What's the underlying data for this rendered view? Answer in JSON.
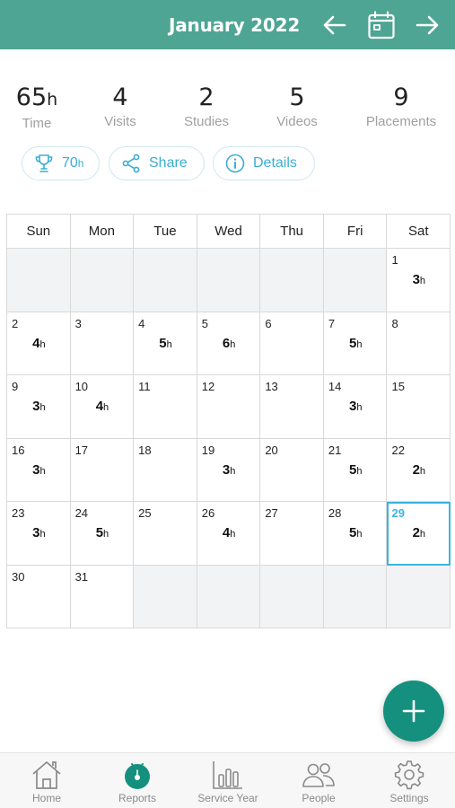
{
  "header": {
    "title": "January 2022",
    "prev_icon": "arrow-left-icon",
    "calendar_icon": "calendar-icon",
    "next_icon": "arrow-right-icon",
    "color": "#4ea593"
  },
  "stats": [
    {
      "value": "65",
      "unit": "h",
      "label": "Time"
    },
    {
      "value": "4",
      "unit": "",
      "label": "Visits"
    },
    {
      "value": "2",
      "unit": "",
      "label": "Studies"
    },
    {
      "value": "5",
      "unit": "",
      "label": "Videos"
    },
    {
      "value": "9",
      "unit": "",
      "label": "Placements"
    }
  ],
  "actions": {
    "goal": {
      "value": "70",
      "unit": "h",
      "icon": "trophy-icon"
    },
    "share": {
      "label": "Share",
      "icon": "share-icon"
    },
    "details": {
      "label": "Details",
      "icon": "info-icon"
    }
  },
  "calendar": {
    "weekdays": [
      "Sun",
      "Mon",
      "Tue",
      "Wed",
      "Thu",
      "Fri",
      "Sat"
    ],
    "hours_unit": "h",
    "today": "29",
    "accent": "#3ab6e0",
    "weeks": [
      [
        null,
        null,
        null,
        null,
        null,
        null,
        {
          "day": "1",
          "hours": "3"
        }
      ],
      [
        {
          "day": "2",
          "hours": "4"
        },
        {
          "day": "3",
          "hours": ""
        },
        {
          "day": "4",
          "hours": "5"
        },
        {
          "day": "5",
          "hours": "6"
        },
        {
          "day": "6",
          "hours": ""
        },
        {
          "day": "7",
          "hours": "5"
        },
        {
          "day": "8",
          "hours": ""
        }
      ],
      [
        {
          "day": "9",
          "hours": "3"
        },
        {
          "day": "10",
          "hours": "4"
        },
        {
          "day": "11",
          "hours": ""
        },
        {
          "day": "12",
          "hours": ""
        },
        {
          "day": "13",
          "hours": ""
        },
        {
          "day": "14",
          "hours": "3"
        },
        {
          "day": "15",
          "hours": ""
        }
      ],
      [
        {
          "day": "16",
          "hours": "3"
        },
        {
          "day": "17",
          "hours": ""
        },
        {
          "day": "18",
          "hours": ""
        },
        {
          "day": "19",
          "hours": "3"
        },
        {
          "day": "20",
          "hours": ""
        },
        {
          "day": "21",
          "hours": "5"
        },
        {
          "day": "22",
          "hours": "2"
        }
      ],
      [
        {
          "day": "23",
          "hours": "3"
        },
        {
          "day": "24",
          "hours": "5"
        },
        {
          "day": "25",
          "hours": ""
        },
        {
          "day": "26",
          "hours": "4"
        },
        {
          "day": "27",
          "hours": ""
        },
        {
          "day": "28",
          "hours": "5"
        },
        {
          "day": "29",
          "hours": "2"
        }
      ],
      [
        {
          "day": "30",
          "hours": ""
        },
        {
          "day": "31",
          "hours": ""
        },
        null,
        null,
        null,
        null,
        null
      ]
    ]
  },
  "fab": {
    "icon": "plus-icon",
    "color": "#16907e"
  },
  "tabs": [
    {
      "label": "Home",
      "icon": "home-icon"
    },
    {
      "label": "Reports",
      "icon": "reports-icon"
    },
    {
      "label": "Service Year",
      "icon": "bar-chart-icon"
    },
    {
      "label": "People",
      "icon": "people-icon"
    },
    {
      "label": "Settings",
      "icon": "gear-icon"
    }
  ]
}
